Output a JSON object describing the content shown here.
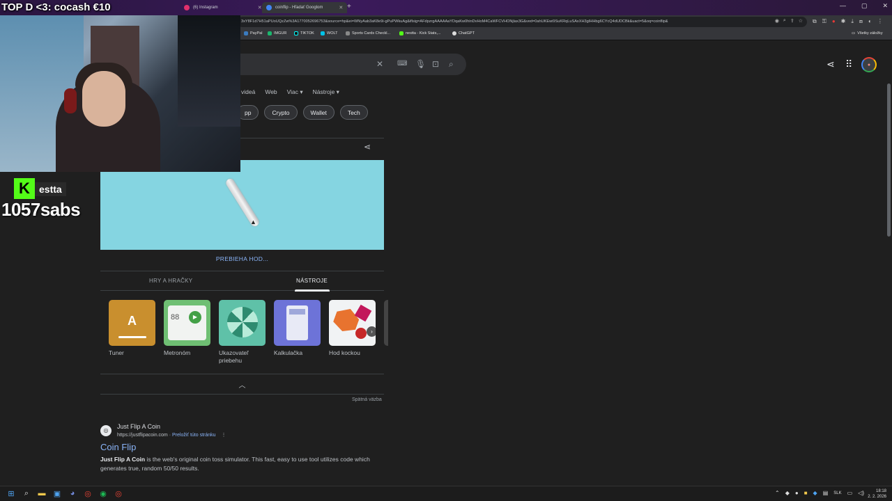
{
  "browser": {
    "tabs": [
      {
        "label": "(6) Instagram",
        "active": false
      },
      {
        "label": "coinflip - Hľadať Googlom",
        "active": true
      }
    ],
    "url": "3xY8F1d7H51aPUoUQzZw%3A1770052696753&source=hp&ei=WNyAab3aK8e9i-gPuPWkuAg&iflsig=AFdpzrgAAAAAaYDqaKw0hinDvHoM4CaWFCVHONjlax3G&ved=0ahUKEwi9SuKRqLuSAxXH3gIHHbg6CYcQ4dUDCBk&uact=5&oq=coinflip&",
    "bookmarks": [
      "PayPal",
      "IMGUR",
      "TIKTOK",
      "WOLT",
      "Sports Cards Checkl...",
      "nestta - Kick Stats,...",
      "ChatGPT"
    ],
    "all_bookmarks": "Všetky záložky"
  },
  "stream": {
    "title": "TOP D <3: cocash €10",
    "kick_logo": "K",
    "channel": "estta",
    "sabs": "1057sabs"
  },
  "google": {
    "nav_tabs": [
      "videá",
      "Web",
      "Viac ▾",
      "Nástroje ▾"
    ],
    "chips": [
      "pp",
      "Crypto",
      "Wallet",
      "Tech"
    ],
    "status": "PREBIEHA HOD...",
    "card_tabs": {
      "inactive": "HRY A HRAČKY",
      "active": "NÁSTROJE"
    },
    "tools": [
      {
        "label": "Tuner",
        "glyph": "A"
      },
      {
        "label": "Metronóm",
        "glyph": "88"
      },
      {
        "label": "Ukazovateľ priebehu"
      },
      {
        "label": "Kalkulačka"
      },
      {
        "label": "Hod kockou"
      }
    ],
    "feedback": "Spätná väzba",
    "result": {
      "site_name": "Just Flip A Coin",
      "url": "https://justflipacoin.com",
      "translate": "Preložiť túto stránku",
      "title": "Coin Flip",
      "snippet_bold": "Just Flip A Coin",
      "snippet_rest": " is the web's original coin toss simulator. This fast, easy to use tool utilizes code which generates true, random 50/50 results."
    }
  },
  "taskbar": {
    "lang": "SLK",
    "time": "18:18",
    "date": "2. 2. 2026"
  }
}
